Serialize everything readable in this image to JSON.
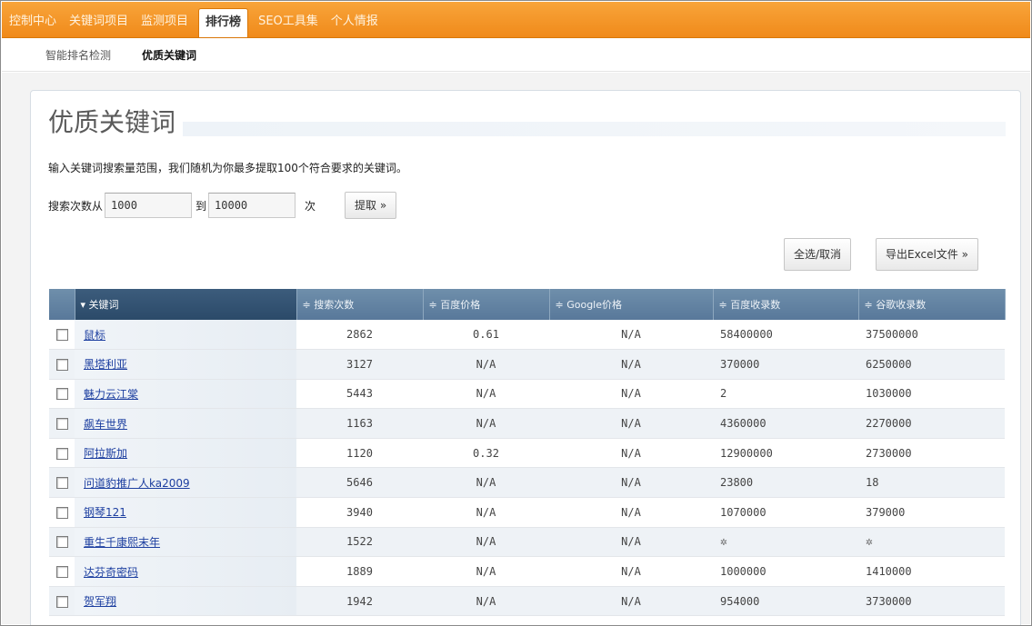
{
  "nav": {
    "items": [
      {
        "label": "控制中心",
        "active": false
      },
      {
        "label": "关键词项目",
        "active": false
      },
      {
        "label": "监测项目",
        "active": false
      },
      {
        "label": "排行榜",
        "active": true
      },
      {
        "label": "SEO工具集",
        "active": false
      },
      {
        "label": "个人情报",
        "active": false
      }
    ]
  },
  "subnav": {
    "items": [
      {
        "label": "智能排名检测",
        "active": false
      },
      {
        "label": "优质关键词",
        "active": true
      }
    ]
  },
  "page": {
    "title": "优质关键词",
    "description": "输入关键词搜索量范围，我们随机为你最多提取100个符合要求的关键词。"
  },
  "range": {
    "from_label": "搜索次数从",
    "from_value": "1000",
    "to_label": "到",
    "to_value": "10000",
    "unit": "次",
    "fetch_label": "提取 »"
  },
  "actions": {
    "select_all_label": "全选/取消",
    "export_label": "导出Excel文件 »"
  },
  "table": {
    "columns": [
      "▾ 关键词",
      "≑ 搜索次数",
      "≑ 百度价格",
      "≑ Google价格",
      "≑ 百度收录数",
      "≑ 谷歌收录数"
    ],
    "rows": [
      {
        "keyword": "鼠标",
        "searches": "2862",
        "baidu_price": "0.61",
        "google_price": "N/A",
        "baidu_index": "58400000",
        "google_index": "37500000"
      },
      {
        "keyword": "黑塔利亚",
        "searches": "3127",
        "baidu_price": "N/A",
        "google_price": "N/A",
        "baidu_index": "370000",
        "google_index": "6250000"
      },
      {
        "keyword": "魅力云江棠",
        "searches": "5443",
        "baidu_price": "N/A",
        "google_price": "N/A",
        "baidu_index": "2",
        "google_index": "1030000"
      },
      {
        "keyword": "飙车世界",
        "searches": "1163",
        "baidu_price": "N/A",
        "google_price": "N/A",
        "baidu_index": "4360000",
        "google_index": "2270000"
      },
      {
        "keyword": "阿拉斯加",
        "searches": "1120",
        "baidu_price": "0.32",
        "google_price": "N/A",
        "baidu_index": "12900000",
        "google_index": "2730000"
      },
      {
        "keyword": "问道豹推广人ka2009",
        "searches": "5646",
        "baidu_price": "N/A",
        "google_price": "N/A",
        "baidu_index": "23800",
        "google_index": "18"
      },
      {
        "keyword": "钢琴121",
        "searches": "3940",
        "baidu_price": "N/A",
        "google_price": "N/A",
        "baidu_index": "1070000",
        "google_index": "379000"
      },
      {
        "keyword": "重生千康熙末年",
        "searches": "1522",
        "baidu_price": "N/A",
        "google_price": "N/A",
        "baidu_index": "",
        "google_index": "",
        "loading": true
      },
      {
        "keyword": "达芬奇密码",
        "searches": "1889",
        "baidu_price": "N/A",
        "google_price": "N/A",
        "baidu_index": "1000000",
        "google_index": "1410000"
      },
      {
        "keyword": "贺军翔",
        "searches": "1942",
        "baidu_price": "N/A",
        "google_price": "N/A",
        "baidu_index": "954000",
        "google_index": "3730000"
      }
    ]
  },
  "icons": {
    "loading": "spinner-icon"
  }
}
